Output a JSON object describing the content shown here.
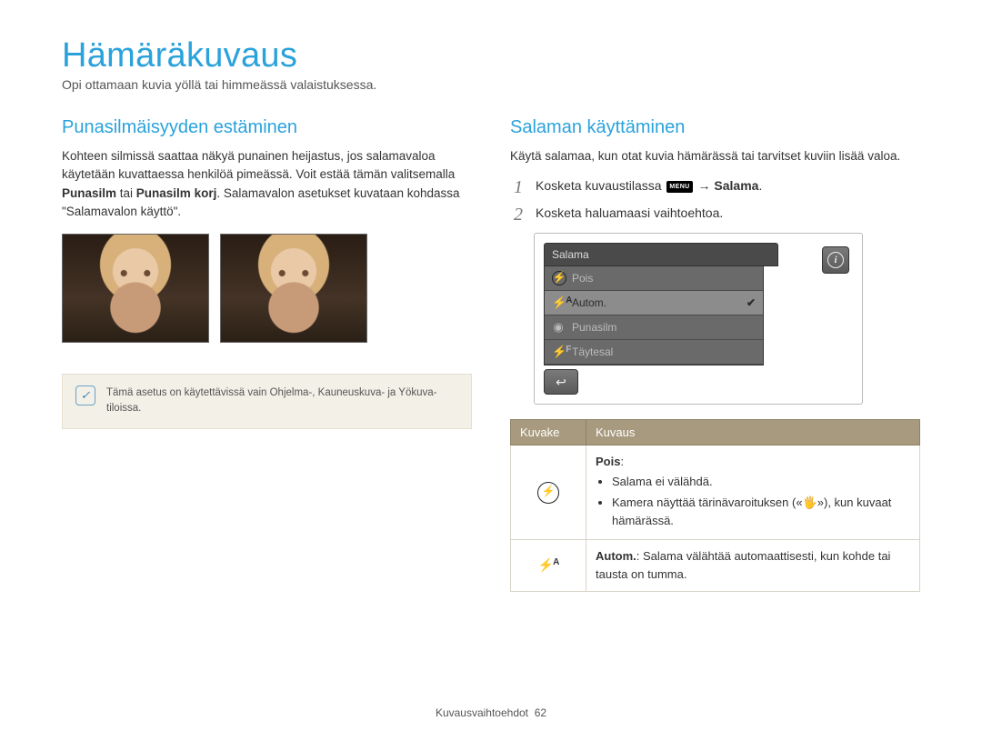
{
  "header": {
    "title": "Hämäräkuvaus",
    "subtitle": "Opi ottamaan kuvia yöllä tai himmeässä valaistuksessa."
  },
  "left": {
    "heading": "Punasilmäisyyden estäminen",
    "para_before_bold1": "Kohteen silmissä saattaa näkyä punainen heijastus, jos salamavaloa käytetään kuvattaessa henkilöä pimeässä. Voit estää tämän valitsemalla ",
    "bold1": "Punasilm",
    "mid1": " tai ",
    "bold2": "Punasilm korj",
    "after_bold2": ". Salamavalon asetukset kuvataan kohdassa \"Salamavalon käyttö\".",
    "note_text": "Tämä asetus on käytettävissä vain Ohjelma-, Kauneuskuva- ja Yökuva-tiloissa."
  },
  "right": {
    "heading": "Salaman käyttäminen",
    "intro": "Käytä salamaa, kun otat kuvia hämärässä tai tarvitset kuviin lisää valoa.",
    "steps": {
      "s1_before": "Kosketa kuvaustilassa ",
      "s1_chip": "MENU",
      "s1_after_arrow": " → ",
      "s1_bold": "Salama",
      "s1_period": ".",
      "s2": "Kosketa haluamaasi vaihtoehtoa."
    },
    "panel": {
      "title": "Salama",
      "rows": [
        {
          "icon": "flash-off",
          "label": "Pois",
          "selected": false
        },
        {
          "icon": "flash-auto",
          "label": "Autom.",
          "selected": true
        },
        {
          "icon": "redeye",
          "label": "Punasilm",
          "selected": false
        },
        {
          "icon": "fill",
          "label": "Täytesal",
          "selected": false
        }
      ]
    },
    "table": {
      "head_icon": "Kuvake",
      "head_desc": "Kuvaus",
      "rows": {
        "r1_title": "Pois",
        "r1_title_colon": ":",
        "r1_b1": "Salama ei välähdä.",
        "r1_b2_before": "Kamera näyttää tärinävaroituksen (",
        "r1_b2_after": "), kun kuvaat hämärässä.",
        "r2_bold": "Autom.",
        "r2_rest": ": Salama välähtää automaattisesti, kun kohde tai tausta on tumma."
      }
    }
  },
  "footer": {
    "label": "Kuvausvaihtoehdot",
    "page": "62"
  }
}
